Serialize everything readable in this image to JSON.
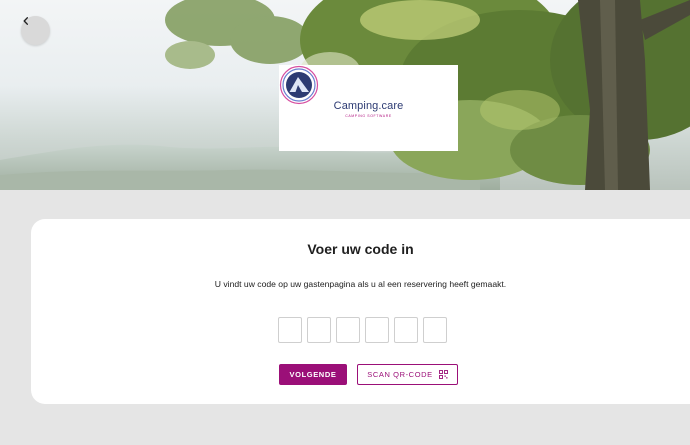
{
  "header": {
    "back_icon": "chevron-left-icon",
    "logo": {
      "name": "Camping.care",
      "subtitle": "CAMPING SOFTWARE",
      "icon": "tent-logo-icon"
    }
  },
  "card": {
    "title": "Voer uw code in",
    "description": "U vindt uw code op uw gastenpagina als u al een reservering heeft gemaakt.",
    "code_boxes": [
      "",
      "",
      "",
      "",
      "",
      ""
    ],
    "next_label": "VOLGENDE",
    "scan_label": "SCAN QR-CODE",
    "scan_icon": "qr-code-icon"
  },
  "colors": {
    "accent": "#9b0f78",
    "page_background": "#e5e5e5",
    "card_background": "#ffffff"
  }
}
